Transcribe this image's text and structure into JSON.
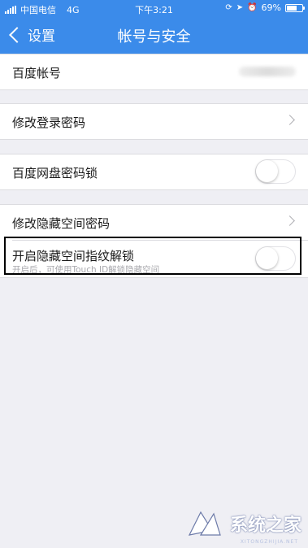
{
  "status_bar": {
    "carrier": "中国电信",
    "network": "4G",
    "time": "下午3:21",
    "battery_percent": "69%",
    "battery_level": 0.69
  },
  "nav": {
    "back_label": "设置",
    "title": "帐号与安全"
  },
  "rows": {
    "account": {
      "label": "百度帐号"
    },
    "change_login_password": {
      "label": "修改登录密码"
    },
    "netdisk_lock": {
      "label": "百度网盘密码锁",
      "enabled": false
    },
    "change_hidden_space_password": {
      "label": "修改隐藏空间密码"
    },
    "hidden_space_touch_id": {
      "label": "开启隐藏空间指纹解锁",
      "sublabel": "开启后，可使用Touch ID解锁隐藏空间",
      "enabled": false
    }
  },
  "watermark": {
    "text": "系统之家",
    "sub": "XITONGZHIJIA.NET"
  },
  "colors": {
    "nav_background": "#3b8bea",
    "page_background": "#efeff4"
  }
}
